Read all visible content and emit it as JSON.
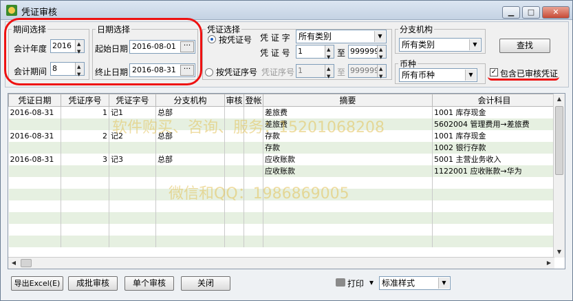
{
  "window": {
    "title": "凭证审核",
    "minimize": "▁",
    "maximize": "□",
    "close": "✕"
  },
  "period": {
    "legend": "期间选择",
    "year_label": "会计年度",
    "year_value": "2016",
    "period_label": "会计期间",
    "period_value": "8"
  },
  "date": {
    "legend": "日期选择",
    "start_label": "起始日期",
    "start_value": "2016-08-01",
    "end_label": "终止日期",
    "end_value": "2016-08-31",
    "picker": "···"
  },
  "voucher": {
    "legend": "凭证选择",
    "by_number_label": "按凭证号",
    "by_seq_label": "按凭证序号",
    "word_label": "凭 证 字",
    "word_value": "所有类别",
    "number_label": "凭 证 号",
    "number_from": "1",
    "number_to": "999999",
    "seq_label": "凭证序号",
    "seq_from": "1",
    "seq_to": "999999",
    "to_label": "至"
  },
  "branch": {
    "legend": "分支机构",
    "value": "所有类别"
  },
  "currency": {
    "legend": "币种",
    "value": "所有币种"
  },
  "search_button": "查找",
  "include_checked_label": "包含已审核凭证",
  "table": {
    "columns": [
      "凭证日期",
      "凭证序号",
      "凭证字号",
      "分支机构",
      "审核",
      "登帐",
      "摘要",
      "会计科目"
    ],
    "rows": [
      [
        "2016-08-31",
        "1",
        "记1",
        "总部",
        "",
        "",
        "差旅费",
        "1001 库存现金"
      ],
      [
        "",
        "",
        "",
        "",
        "",
        "",
        "差旅费",
        "5602004 管理费用→差旅费"
      ],
      [
        "2016-08-31",
        "2",
        "记2",
        "总部",
        "",
        "",
        "存款",
        "1001 库存现金"
      ],
      [
        "",
        "",
        "",
        "",
        "",
        "",
        "存款",
        "1002 银行存款"
      ],
      [
        "2016-08-31",
        "3",
        "记3",
        "总部",
        "",
        "",
        "应收账款",
        "5001 主营业务收入"
      ],
      [
        "",
        "",
        "",
        "",
        "",
        "",
        "应收账款",
        "1122001 应收账款→华为"
      ],
      [
        "",
        "",
        "",
        "",
        "",
        "",
        "",
        ""
      ],
      [
        "",
        "",
        "",
        "",
        "",
        "",
        "",
        ""
      ],
      [
        "",
        "",
        "",
        "",
        "",
        "",
        "",
        ""
      ],
      [
        "",
        "",
        "",
        "",
        "",
        "",
        "",
        ""
      ],
      [
        "",
        "",
        "",
        "",
        "",
        "",
        "",
        ""
      ],
      [
        "",
        "",
        "",
        "",
        "",
        "",
        "",
        ""
      ]
    ]
  },
  "watermark1": "软件购买、咨询、服务：15201068208",
  "watermark2": "微信和QQ：1986869005",
  "footer": {
    "export": "导出Excel(E)",
    "batch_audit": "成批审核",
    "single_audit": "单个审核",
    "close": "关闭",
    "print": "打印",
    "print_dropdown": "▾",
    "style_value": "标准样式"
  },
  "colors": {
    "red_highlight": "#ee1111",
    "row_alt": "#e6f0e1",
    "watermark": "#e3c35a"
  }
}
